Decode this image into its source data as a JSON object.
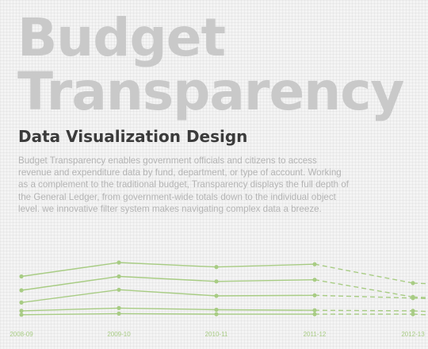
{
  "hero": {
    "title_line1": "Budget",
    "title_line2": "Transparency",
    "subtitle": "Data Visualization Design",
    "description": "Budget Transparency enables government officials and citizens to access revenue and expenditure data by fund, department, or type of account. Working as a complement to the traditional budget, Transparency displays the full depth of the General Ledger, from government-wide totals down to the individual object level. we innovative filter system makes navigating complex data a breeze."
  },
  "colors": {
    "title": "#c9c9c9",
    "subtitle": "#3b3b3b",
    "body": "#b4b4b4",
    "line": "#a8cc84",
    "point": "#a8cc84"
  },
  "chart_data": {
    "type": "line",
    "categories": [
      "2008-09",
      "2009-10",
      "2010-11",
      "2011-12",
      "2012-13"
    ],
    "projected_from_index": 3,
    "grid": false,
    "series": [
      {
        "values": [
          95,
          120,
          112,
          117,
          83
        ]
      },
      {
        "values": [
          70,
          95,
          86,
          89,
          58
        ]
      },
      {
        "values": [
          48,
          71,
          60,
          61,
          56
        ]
      },
      {
        "values": [
          33,
          38,
          35,
          34,
          33
        ]
      },
      {
        "values": [
          26,
          28,
          27,
          27,
          27
        ]
      }
    ],
    "ylim": [
      0,
      135
    ]
  }
}
